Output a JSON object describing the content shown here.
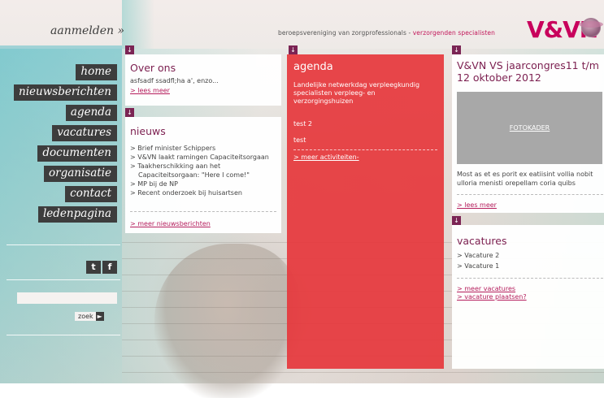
{
  "header": {
    "login_label": "aanmelden »",
    "tagline_main": "beroepsvereniging van zorgprofessionals - ",
    "tagline_accent": "verzorgenden specialisten",
    "logo_text": "V&VN"
  },
  "sidebar": {
    "nav": [
      "home",
      "nieuwsberichten",
      "agenda",
      "vacatures",
      "documenten",
      "organisatie",
      "contact",
      "ledenpagina"
    ],
    "social": {
      "twitter": "t",
      "facebook": "f"
    },
    "search": {
      "placeholder": "",
      "button_label": "zoek"
    }
  },
  "over_ons": {
    "title": "Over ons",
    "body": "asfsadf ssadfl;ha a', enzo...",
    "link": "> lees meer"
  },
  "nieuws": {
    "title": "nieuws",
    "items": [
      "> Brief minister Schippers",
      "> V&VN laakt ramingen Capaciteitsorgaan",
      "> Taakherschikking aan het",
      "Capaciteitsorgaan: \"Here I come!\"",
      "> MP bij de NP",
      "> Recent onderzoek bij huisartsen"
    ],
    "link": "> meer nieuwsberichten"
  },
  "agenda": {
    "title": "agenda",
    "items": [
      "Landelijke netwerkdag verpleegkundig",
      "specialisten verpleeg- en",
      "verzorgingshuizen"
    ],
    "item2": "test 2",
    "item3": "test",
    "link": "> meer activiteiten-"
  },
  "congres": {
    "title_line1": "V&VN VS jaarcongres11 t/m",
    "title_line2": "12 oktober 2012",
    "image_label": "FOTOKADER",
    "body_line1": "Most as et es porit ex eatiisint vollia nobit",
    "body_line2": "ulloria menisti orepellam coria quibs",
    "link": "> lees meer"
  },
  "vacatures": {
    "title": "vacatures",
    "items": [
      "> Vacature 2",
      "> Vacature 1"
    ],
    "link1": "> meer vacatures",
    "link2": "> vacature plaatsen?"
  },
  "tab_arrow": "↓"
}
